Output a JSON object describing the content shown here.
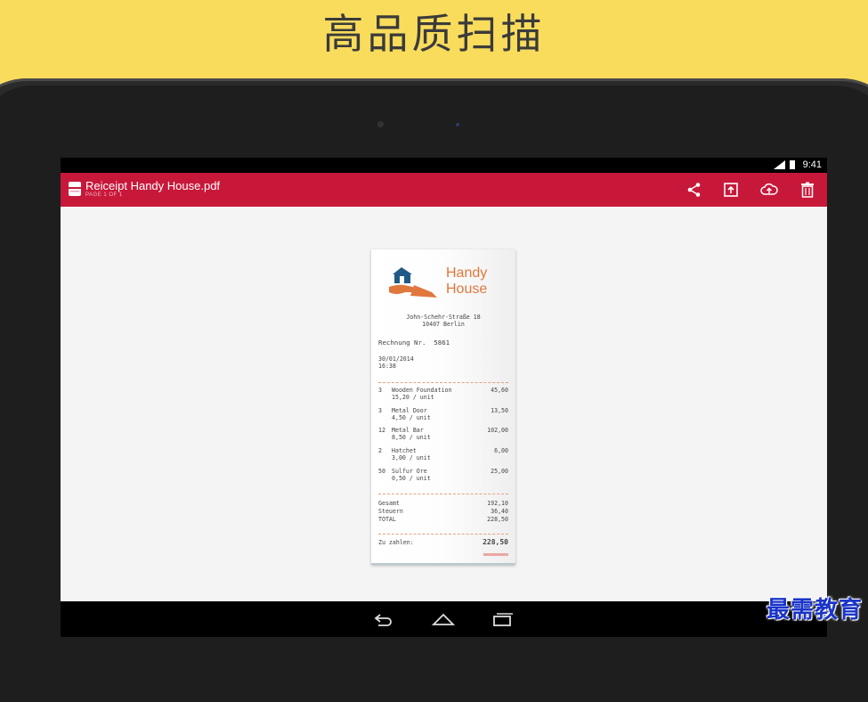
{
  "headline": "高品质扫描",
  "status_bar": {
    "time": "9:41",
    "network": "4G"
  },
  "app_bar": {
    "filename": "Reiceipt Handy House.pdf",
    "page_info": "PAGE 1 OF 1",
    "actions": [
      "share-icon",
      "export-icon",
      "cloud-upload-icon",
      "delete-icon"
    ],
    "color": "#c8183a"
  },
  "receipt": {
    "logo_line1": "Handy",
    "logo_line2": "House",
    "address_line1": "John-Schehr-Straße 18",
    "address_line2": "10407 Berlin",
    "invoice_label": "Rechnung Nr.  5861",
    "date": "30/01/2014",
    "time": "16:38",
    "items": [
      {
        "qty": "3",
        "name": "Wooden Foundation",
        "unit": "15,20 / unit",
        "total": "45,60"
      },
      {
        "qty": "3",
        "name": "Metal Door",
        "unit": "4,50 / unit",
        "total": "13,50"
      },
      {
        "qty": "12",
        "name": "Metal Bar",
        "unit": "8,50 / unit",
        "total": "102,00"
      },
      {
        "qty": "2",
        "name": "Hatchet",
        "unit": "3,00 / unit",
        "total": "6,00"
      },
      {
        "qty": "50",
        "name": "Sulfur Ore",
        "unit": "0,50 / unit",
        "total": "25,00"
      }
    ],
    "summary": [
      {
        "label": "Gesamt",
        "value": "192,10"
      },
      {
        "label": "Steuern",
        "value": "36,40"
      },
      {
        "label": "TOTAL",
        "value": "228,50"
      }
    ],
    "pay_label": "Zu zahlen:",
    "pay_value": "228,50",
    "accent_color": "#e0773d"
  },
  "nav_bar": [
    "back-icon",
    "home-icon",
    "recents-icon"
  ],
  "watermark": "最需教育"
}
